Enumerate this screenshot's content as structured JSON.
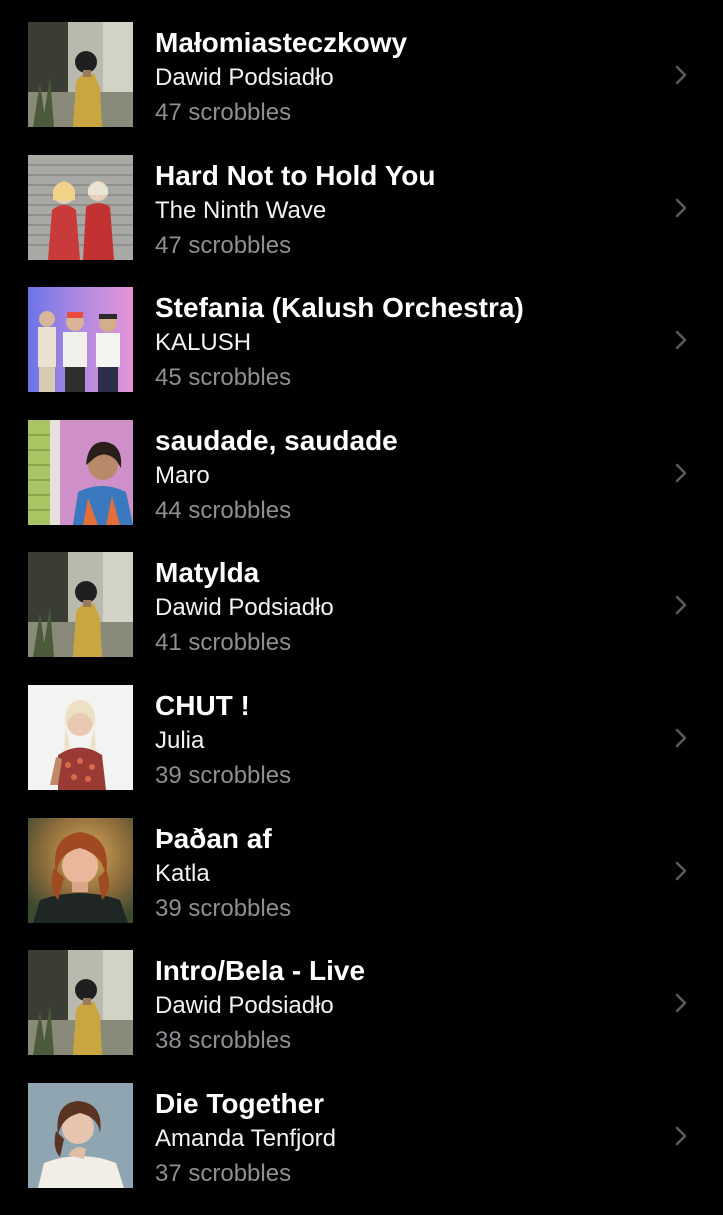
{
  "tracks": [
    {
      "title": "Małomiasteczkowy",
      "artist": "Dawid Podsiadło",
      "scrobbles": "47 scrobbles"
    },
    {
      "title": "Hard Not to Hold You",
      "artist": "The Ninth Wave",
      "scrobbles": "47 scrobbles"
    },
    {
      "title": "Stefania (Kalush Orchestra)",
      "artist": "KALUSH",
      "scrobbles": "45 scrobbles"
    },
    {
      "title": "saudade, saudade",
      "artist": "Maro",
      "scrobbles": "44 scrobbles"
    },
    {
      "title": "Matylda",
      "artist": "Dawid Podsiadło",
      "scrobbles": "41 scrobbles"
    },
    {
      "title": "CHUT !",
      "artist": "Julia",
      "scrobbles": "39 scrobbles"
    },
    {
      "title": "Þaðan af",
      "artist": "Katla",
      "scrobbles": "39 scrobbles"
    },
    {
      "title": "Intro/Bela - Live",
      "artist": "Dawid Podsiadło",
      "scrobbles": "38 scrobbles"
    },
    {
      "title": "Die Together",
      "artist": "Amanda Tenfjord",
      "scrobbles": "37 scrobbles"
    }
  ],
  "theme": {
    "background": "#000000",
    "title_color": "#ffffff",
    "secondary_color": "#8e8e93",
    "chevron_color": "#5a5a5e"
  },
  "icons": {
    "row_chevron": "chevron-right-icon"
  }
}
